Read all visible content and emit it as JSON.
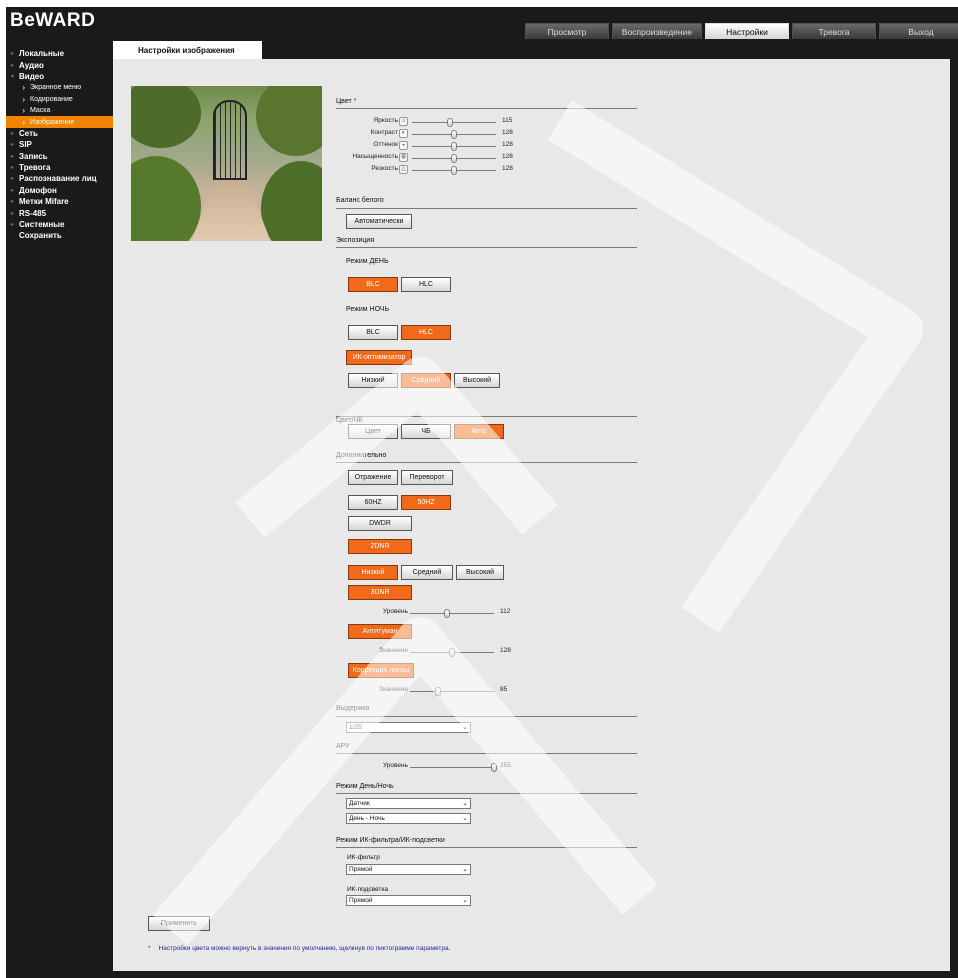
{
  "header": {
    "logo": "BeWARD",
    "tabs": [
      "Просмотр",
      "Воспроизведение",
      "Настройки",
      "Тревога",
      "Выход"
    ],
    "active_tab": "Настройки"
  },
  "sidebar": {
    "items": [
      {
        "label": "Локальные",
        "type": "main"
      },
      {
        "label": "Аудио",
        "type": "main"
      },
      {
        "label": "Видео",
        "type": "main",
        "expanded": true
      },
      {
        "label": "Экранное меню",
        "type": "sub"
      },
      {
        "label": "Кодирование",
        "type": "sub"
      },
      {
        "label": "Маска",
        "type": "sub"
      },
      {
        "label": "Изображение",
        "type": "sub",
        "active": true
      },
      {
        "label": "Сеть",
        "type": "main"
      },
      {
        "label": "SIP",
        "type": "main"
      },
      {
        "label": "Запись",
        "type": "main"
      },
      {
        "label": "Тревога",
        "type": "main"
      },
      {
        "label": "Распознавание лиц",
        "type": "main"
      },
      {
        "label": "Домофон",
        "type": "main"
      },
      {
        "label": "Метки Mifare",
        "type": "main"
      },
      {
        "label": "RS-485",
        "type": "main"
      },
      {
        "label": "Системные",
        "type": "main"
      },
      {
        "label": "Сохранить",
        "type": "plain"
      }
    ]
  },
  "page_tab": "Настройки изображения",
  "color": {
    "title": "Цвет",
    "required_mark": "*",
    "sliders": [
      {
        "label": "Яркость",
        "value": 115,
        "max": 255
      },
      {
        "label": "Контраст",
        "value": 128,
        "max": 255
      },
      {
        "label": "Оттенок",
        "value": 128,
        "max": 255
      },
      {
        "label": "Насыщенность",
        "value": 128,
        "max": 255
      },
      {
        "label": "Резкость",
        "value": 128,
        "max": 255
      }
    ]
  },
  "white_balance": {
    "title": "Баланс белого",
    "button": "Автоматически"
  },
  "exposure": {
    "title": "Экспозиция",
    "day_title": "Режим ДЕНЬ",
    "day_buttons": [
      {
        "label": "BLC",
        "on": true
      },
      {
        "label": "HLC",
        "on": false
      }
    ],
    "night_title": "Режим НОЧЬ",
    "night_buttons": [
      {
        "label": "BLC",
        "on": false
      },
      {
        "label": "HLC",
        "on": true
      }
    ],
    "ir_optimizer": "ИК-оптимизатор",
    "ir_levels": [
      {
        "label": "Низкий",
        "on": false
      },
      {
        "label": "Средний",
        "on": true
      },
      {
        "label": "Высокий",
        "on": false
      }
    ]
  },
  "color_bw": {
    "title": "Цвет/ЧБ",
    "buttons": [
      {
        "label": "Цвет",
        "on": false
      },
      {
        "label": "ЧБ",
        "on": false
      },
      {
        "label": "Авто",
        "on": true
      }
    ]
  },
  "extra": {
    "title": "Дополнительно",
    "mirror": "Отражение",
    "flip": "Переворот",
    "hz": [
      {
        "label": "60HZ",
        "on": false
      },
      {
        "label": "50HZ",
        "on": true
      }
    ],
    "dwdr": "DWDR",
    "dnr2": "2DNR",
    "dnr2_levels": [
      {
        "label": "Низкий",
        "on": true
      },
      {
        "label": "Средний",
        "on": false
      },
      {
        "label": "Высокий",
        "on": false
      }
    ],
    "dnr3": "3DNR",
    "dnr3_label": "Уровень",
    "dnr3_value": 112,
    "defog": "Антитуман",
    "defog_label": "Значение",
    "defog_value": 128,
    "lens": "Коррекция линзы",
    "lens_label": "Значение",
    "lens_value": 85
  },
  "shutter": {
    "title": "Выдержка",
    "value": "1/25"
  },
  "agc": {
    "title": "АРУ",
    "label": "Уровень",
    "value": 255
  },
  "daynight": {
    "title": "Режим День/Ночь",
    "mode": "Датчик",
    "schedule": "День - Ночь"
  },
  "ir": {
    "title": "Режим ИК-фильтра/ИК-подсветки",
    "filter_label": "ИК-фильтр",
    "filter_value": "Прямой",
    "light_label": "ИК-подсветка",
    "light_value": "Прямой"
  },
  "apply": "Применить",
  "note_mark": "*",
  "note": "Настройки цвета можно вернуть в значения по умолчанию, щелкнув по пиктограмме параметра.",
  "colors": {
    "accent": "#f06a1a",
    "sidebar_active": "#f08400",
    "background": "#1a1a1a",
    "panel": "#e8e8e8"
  }
}
